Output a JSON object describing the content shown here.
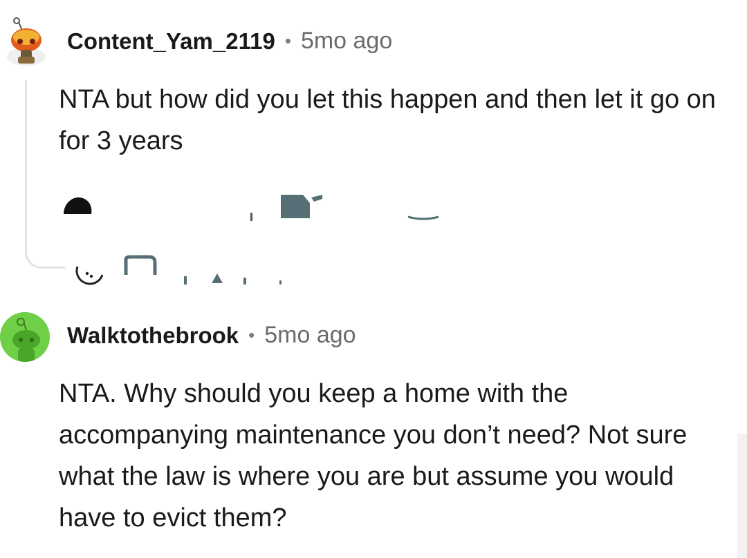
{
  "comments": [
    {
      "username": "Content_Yam_2119",
      "separator": "•",
      "time": "5mo ago",
      "body": "NTA but how did you let this happen and then let it go on for 3 years",
      "avatar_icon": "snoo-helmet-avatar-icon"
    },
    {
      "username": "Walktothebrook",
      "separator": "•",
      "time": "5mo ago",
      "body": "NTA. Why should you keep a home with the accompanying maintenance you don’t need? Not sure what the law is where you are but assume you would have to evict them?",
      "avatar_icon": "snoo-green-avatar-icon"
    }
  ],
  "colors": {
    "text": "#1a1a1b",
    "meta": "#6b6b6b",
    "thread_line": "#e4e4e4",
    "avatar2_bg": "#6fd047"
  }
}
